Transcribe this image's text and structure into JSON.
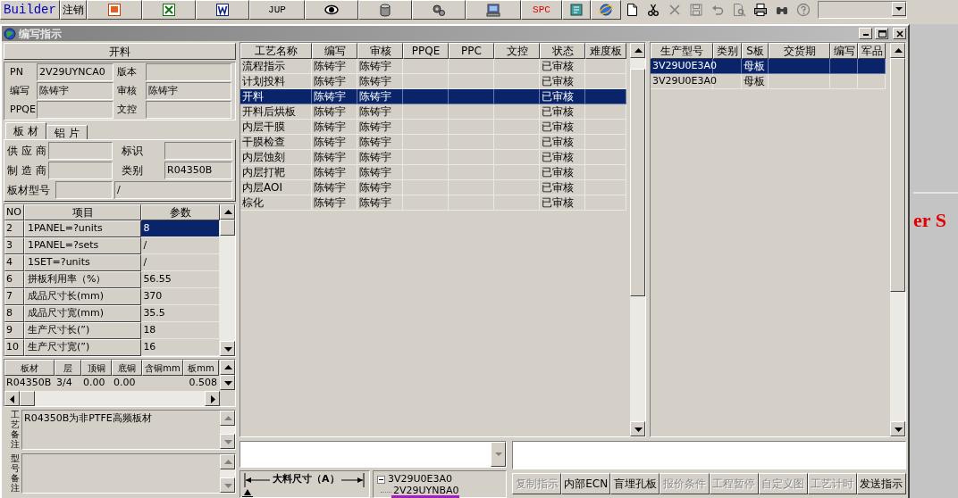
{
  "toolbar": {
    "buttons": [
      "Builder",
      "注销",
      "JUP",
      "SPC"
    ]
  },
  "window": {
    "title": "编写指示"
  },
  "process_header": "开料",
  "info_fields": [
    {
      "label": "PN",
      "value": "2V29UYNCA0"
    },
    {
      "label": "版本"
    },
    {
      "label": "编写",
      "value": "陈铸宇"
    },
    {
      "label": "审核",
      "value": "陈铸宇"
    },
    {
      "label": "PPQE"
    },
    {
      "label": "文控"
    }
  ],
  "material_tabs": [
    {
      "label": "板 材",
      "selected": true
    },
    {
      "label": "铝 片",
      "selected": false
    }
  ],
  "material_fields": [
    {
      "label": "供 应 商"
    },
    {
      "label": "标识"
    },
    {
      "label": "制 造 商"
    },
    {
      "label": "类别",
      "value": "R04350B"
    }
  ],
  "board_model": {
    "label": "板材型号",
    "spec": "/"
  },
  "params": {
    "columns": [
      "NO",
      "项目",
      "参数"
    ],
    "rows": [
      {
        "no": "2",
        "item": "1PANEL=?units",
        "value": "8",
        "selected": true
      },
      {
        "no": "3",
        "item": "1PANEL=?sets",
        "value": "/",
        "selected": false
      },
      {
        "no": "4",
        "item": "1SET=?units",
        "value": "/",
        "selected": false
      },
      {
        "no": "6",
        "item": "拼板利用率（%）",
        "value": "56.55",
        "selected": false
      },
      {
        "no": "7",
        "item": "成品尺寸长(mm)",
        "value": "370",
        "selected": false
      },
      {
        "no": "8",
        "item": "成品尺寸宽(mm)",
        "value": "35.5",
        "selected": false
      },
      {
        "no": "9",
        "item": "生产尺寸长(”)",
        "value": "18",
        "selected": false
      },
      {
        "no": "10",
        "item": "生产尺寸宽(”)",
        "value": "16",
        "selected": false
      }
    ]
  },
  "materials": {
    "columns": [
      "板材",
      "层",
      "顶铜",
      "底铜",
      "含铜mm",
      "板mm"
    ],
    "rows": [
      {
        "cells": [
          "R04350B",
          "3/4",
          "0.00",
          "0.00",
          null,
          "0.508"
        ]
      }
    ]
  },
  "remarks": [
    {
      "label": "工艺备注",
      "text": "R04350B为非PTFE高频板材"
    },
    {
      "label": "型号备注"
    }
  ],
  "process_table": {
    "columns": [
      "工艺名称",
      "编写",
      "审核",
      "PPQE",
      "PPC",
      "文控",
      "状态",
      "难度板"
    ],
    "rows": [
      {
        "cells": [
          "流程指示",
          "陈铸宇",
          "陈铸宇",
          null,
          null,
          null,
          "已审核",
          null
        ],
        "selected": false
      },
      {
        "cells": [
          "计划投料",
          "陈铸宇",
          "陈铸宇",
          null,
          null,
          null,
          "已审核",
          null
        ],
        "selected": false
      },
      {
        "cells": [
          "开料",
          "陈铸宇",
          "陈铸宇",
          null,
          null,
          null,
          "已审核",
          null
        ],
        "selected": true
      },
      {
        "cells": [
          "开料后烘板",
          "陈铸宇",
          "陈铸宇",
          null,
          null,
          null,
          "已审核",
          null
        ],
        "selected": false
      },
      {
        "cells": [
          "内层干膜",
          "陈铸宇",
          "陈铸宇",
          null,
          null,
          null,
          "已审核",
          null
        ],
        "selected": false
      },
      {
        "cells": [
          "干膜检查",
          "陈铸宇",
          "陈铸宇",
          null,
          null,
          null,
          "已审核",
          null
        ],
        "selected": false
      },
      {
        "cells": [
          "内层蚀刻",
          "陈铸宇",
          "陈铸宇",
          null,
          null,
          null,
          "已审核",
          null
        ],
        "selected": false
      },
      {
        "cells": [
          "内层打靶",
          "陈铸宇",
          "陈铸宇",
          null,
          null,
          null,
          "已审核",
          null
        ],
        "selected": false
      },
      {
        "cells": [
          "内层AOI",
          "陈铸宇",
          "陈铸宇",
          null,
          null,
          null,
          "已审核",
          null
        ],
        "selected": false
      },
      {
        "cells": [
          "棕化",
          "陈铸宇",
          "陈铸宇",
          null,
          null,
          null,
          "已审核",
          null
        ],
        "selected": false
      }
    ]
  },
  "model_table": {
    "columns": [
      "生产型号",
      "类别",
      "S板",
      "交货期",
      "编写",
      "军品"
    ],
    "rows": [
      {
        "cells": [
          "3V29U0E3A0",
          null,
          "母板",
          null,
          null,
          null
        ],
        "selected": true
      },
      {
        "cells": [
          "3V29U0E3A0",
          null,
          "母板",
          null,
          null,
          null
        ],
        "selected": false
      }
    ]
  },
  "dimension_label": "大料尺寸（A）",
  "tree": [
    {
      "label": "3V29U0E3A0",
      "expanded": true,
      "selected": false,
      "children": [
        {
          "label": "2V29UYNBA0",
          "selected": true
        }
      ]
    }
  ],
  "actions": [
    {
      "label": "复制指示",
      "disabled": true
    },
    {
      "label": "内部ECN",
      "disabled": false
    },
    {
      "label": "盲埋孔板",
      "disabled": false
    },
    {
      "label": "报价条件",
      "disabled": true
    },
    {
      "label": "工程暂停",
      "disabled": true
    },
    {
      "label": "自定义图",
      "disabled": true
    },
    {
      "label": "工艺计时",
      "disabled": true
    },
    {
      "label": "发送指示",
      "disabled": false
    }
  ],
  "desktop_text": "er S"
}
